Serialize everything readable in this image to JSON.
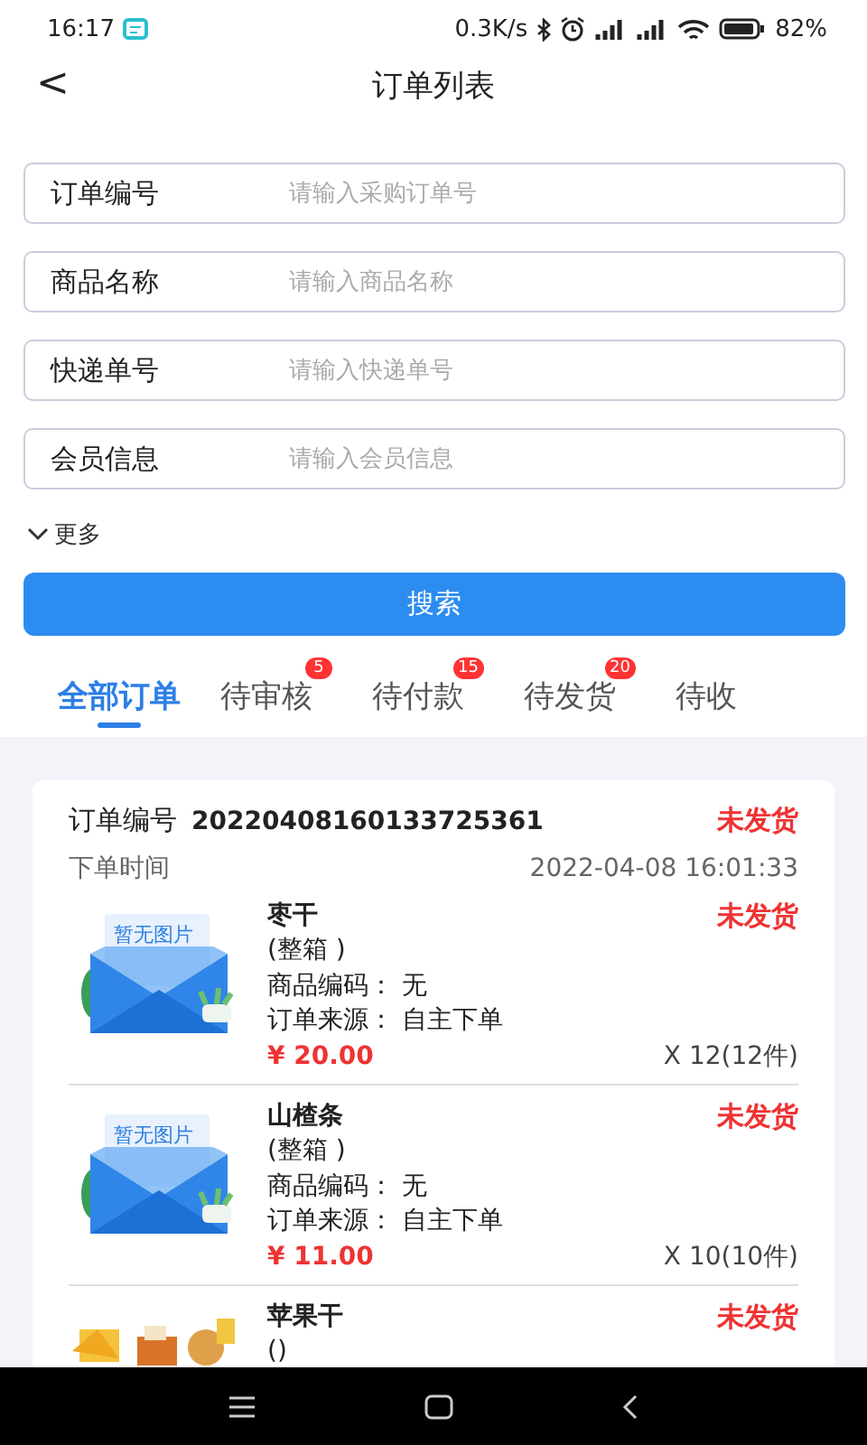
{
  "status_bar": {
    "time": "16:17",
    "speed": "0.3K/s",
    "battery": "82%"
  },
  "header": {
    "back": "<",
    "title": "订单列表"
  },
  "filters": [
    {
      "label": "订单编号",
      "placeholder": "请输入采购订单号"
    },
    {
      "label": "商品名称",
      "placeholder": "请输入商品名称"
    },
    {
      "label": "快递单号",
      "placeholder": "请输入快递单号"
    },
    {
      "label": "会员信息",
      "placeholder": "请输入会员信息"
    }
  ],
  "more": "更多",
  "search_button": "搜索",
  "tabs": [
    {
      "label": "全部订单",
      "selected": true
    },
    {
      "label": "待审核",
      "selected": false,
      "badge": "5"
    },
    {
      "label": "待付款",
      "selected": false,
      "badge": "15"
    },
    {
      "label": "待发货",
      "selected": false,
      "badge": "20"
    },
    {
      "label": "待收",
      "selected": false
    }
  ],
  "order": {
    "number_label": "订单编号",
    "number": "20220408160133725361",
    "status": "未发货",
    "time_label": "下单时间",
    "time": "2022-04-08 16:01:33",
    "items": [
      {
        "image": {
          "kind": "placeholder",
          "text": "暂无图片"
        },
        "name": "枣干",
        "spec": "(整箱 )",
        "code_label": "商品编码：",
        "code": "无",
        "source_label": "订单来源：",
        "source": "自主下单",
        "price": "¥ 20.00",
        "quantity": "X 12(12件)",
        "status": "未发货"
      },
      {
        "image": {
          "kind": "placeholder",
          "text": "暂无图片"
        },
        "name": "山楂条",
        "spec": "(整箱 )",
        "code_label": "商品编码：",
        "code": "无",
        "source_label": "订单来源：",
        "source": "自主下单",
        "price": "¥ 11.00",
        "quantity": "X 10(10件)",
        "status": "未发货"
      },
      {
        "name": "苹果干",
        "spec": "()",
        "status": "未发货"
      }
    ]
  }
}
